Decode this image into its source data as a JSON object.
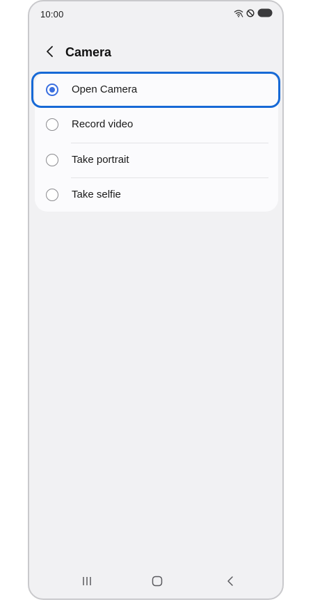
{
  "status_bar": {
    "time": "10:00",
    "icons": [
      "wifi-calling-icon",
      "do-not-disturb-icon",
      "battery-icon"
    ]
  },
  "app_bar": {
    "back_icon": "chevron-left-icon",
    "title": "Camera"
  },
  "options": [
    {
      "label": "Open Camera",
      "selected": true
    },
    {
      "label": "Record video",
      "selected": false
    },
    {
      "label": "Take portrait",
      "selected": false
    },
    {
      "label": "Take selfie",
      "selected": false
    }
  ],
  "nav_bar": {
    "icons": [
      "recent-apps-icon",
      "home-icon",
      "back-icon"
    ]
  },
  "colors": {
    "accent": "#3a6fe0",
    "highlight": "#1669d6",
    "background": "#f1f1f3",
    "card": "#fbfbfd"
  }
}
